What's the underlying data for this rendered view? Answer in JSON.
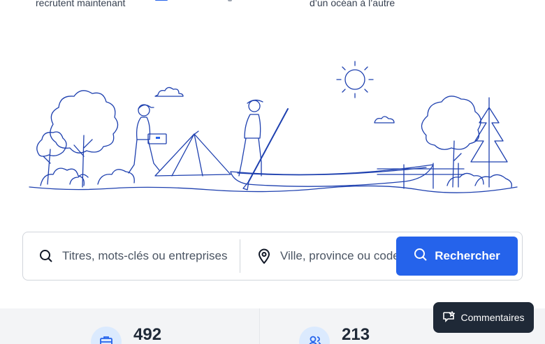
{
  "top_text": {
    "left": "recrutent maintenant",
    "right": "d’un océan à l’autre"
  },
  "search": {
    "what_placeholder": "Titres, mots-clés ou entreprises",
    "where_placeholder": "Ville, province ou code postal",
    "button_label": "Rechercher"
  },
  "stats": [
    {
      "value": "492",
      "icon": "briefcase-icon"
    },
    {
      "value": "213",
      "icon": "users-icon"
    }
  ],
  "feedback": {
    "label": "Commentaires",
    "icon": "feedback-icon"
  },
  "colors": {
    "accent": "#2563eb",
    "illustration_line": "#1e40af",
    "feedback_bg": "#1f2937",
    "stats_bg": "#f3f4f6"
  }
}
